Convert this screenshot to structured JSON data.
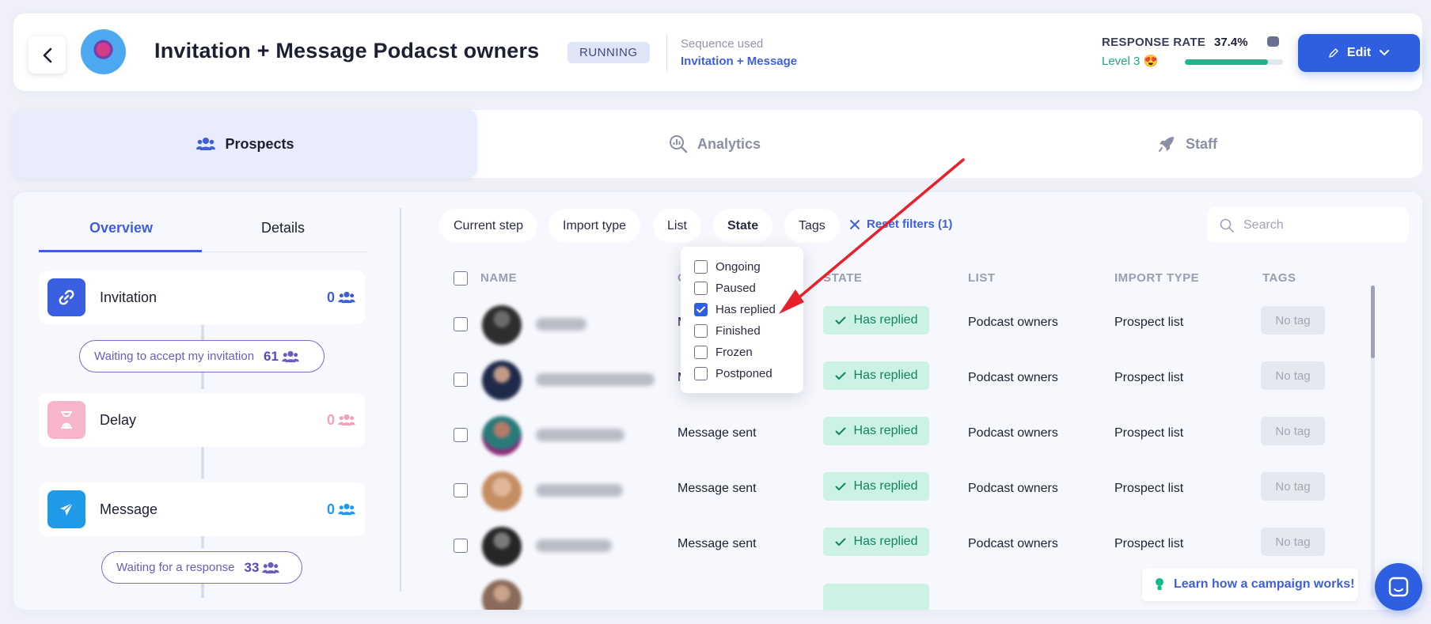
{
  "header": {
    "title": "Invitation + Message Podacst owners",
    "status": "RUNNING",
    "sequence_label": "Sequence used",
    "sequence_value": "Invitation + Message",
    "response_rate_label": "RESPONSE RATE",
    "response_rate_value": "37.4%",
    "response_rate_fraction": 0.85,
    "level": "Level 3 😍",
    "edit_label": "Edit"
  },
  "tabs": {
    "prospects": "Prospects",
    "analytics": "Analytics",
    "staff": "Staff"
  },
  "sidebar": {
    "overview": "Overview",
    "details": "Details",
    "steps": [
      {
        "name": "Invitation",
        "count": "0"
      },
      {
        "name": "Delay",
        "count": "0"
      },
      {
        "name": "Message",
        "count": "0"
      }
    ],
    "waits": [
      {
        "label": "Waiting to accept my invitation",
        "count": "61"
      },
      {
        "label": "Waiting for a response",
        "count": "33"
      }
    ]
  },
  "filters": {
    "current_step": "Current step",
    "import_type": "Import type",
    "list": "List",
    "state": "State",
    "tags": "Tags",
    "reset": "Reset filters (1)",
    "search_placeholder": "Search"
  },
  "state_dropdown": {
    "options": [
      {
        "label": "Ongoing",
        "checked": false
      },
      {
        "label": "Paused",
        "checked": false
      },
      {
        "label": "Has replied",
        "checked": true
      },
      {
        "label": "Finished",
        "checked": false
      },
      {
        "label": "Frozen",
        "checked": false
      },
      {
        "label": "Postponed",
        "checked": false
      }
    ]
  },
  "table": {
    "columns": [
      "NAME",
      "C",
      "STATE",
      "LIST",
      "IMPORT TYPE",
      "TAGS"
    ],
    "rows": [
      {
        "step": "M",
        "state": "Has replied",
        "list": "Podcast owners",
        "import_type": "Prospect list",
        "tags": "No tag"
      },
      {
        "step": "M",
        "state": "Has replied",
        "list": "Podcast owners",
        "import_type": "Prospect list",
        "tags": "No tag"
      },
      {
        "step": "Message sent",
        "state": "Has replied",
        "list": "Podcast owners",
        "import_type": "Prospect list",
        "tags": "No tag"
      },
      {
        "step": "Message sent",
        "state": "Has replied",
        "list": "Podcast owners",
        "import_type": "Prospect list",
        "tags": "No tag"
      },
      {
        "step": "Message sent",
        "state": "Has replied",
        "list": "Podcast owners",
        "import_type": "Prospect list",
        "tags": "No tag"
      }
    ]
  },
  "help": {
    "learn": "Learn how a campaign works!"
  },
  "colors": {
    "accent": "#2f5fe1",
    "success": "#13ba8c",
    "arrow": "#e8202a"
  }
}
